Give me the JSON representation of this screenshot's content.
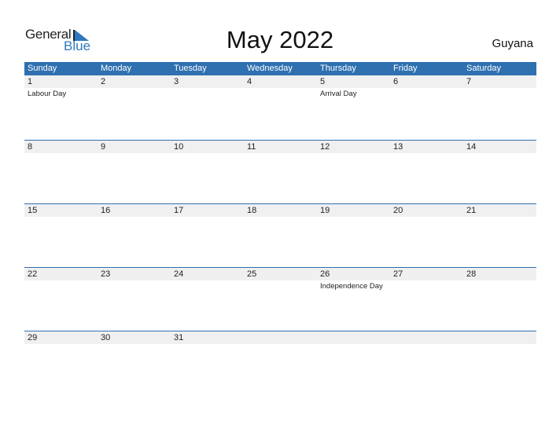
{
  "logo": {
    "general": "General",
    "blue": "Blue"
  },
  "title": "May 2022",
  "country": "Guyana",
  "colors": {
    "accent": "#2e70b0",
    "date_bar": "#f0f0f0"
  },
  "weekdays": [
    "Sunday",
    "Monday",
    "Tuesday",
    "Wednesday",
    "Thursday",
    "Friday",
    "Saturday"
  ],
  "weeks": [
    {
      "dates": [
        "1",
        "2",
        "3",
        "4",
        "5",
        "6",
        "7"
      ],
      "events": [
        "Labour Day",
        "",
        "",
        "",
        "Arrival Day",
        "",
        ""
      ]
    },
    {
      "dates": [
        "8",
        "9",
        "10",
        "11",
        "12",
        "13",
        "14"
      ],
      "events": [
        "",
        "",
        "",
        "",
        "",
        "",
        ""
      ]
    },
    {
      "dates": [
        "15",
        "16",
        "17",
        "18",
        "19",
        "20",
        "21"
      ],
      "events": [
        "",
        "",
        "",
        "",
        "",
        "",
        ""
      ]
    },
    {
      "dates": [
        "22",
        "23",
        "24",
        "25",
        "26",
        "27",
        "28"
      ],
      "events": [
        "",
        "",
        "",
        "",
        "Independence Day",
        "",
        ""
      ]
    },
    {
      "dates": [
        "29",
        "30",
        "31",
        "",
        "",
        "",
        ""
      ],
      "events": [
        "",
        "",
        "",
        "",
        "",
        "",
        ""
      ]
    }
  ]
}
